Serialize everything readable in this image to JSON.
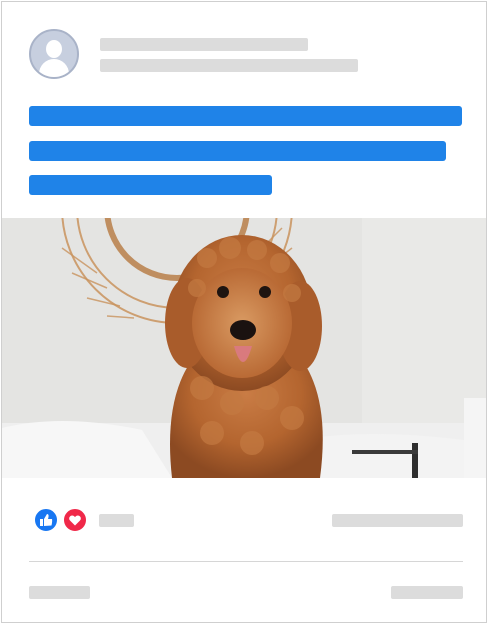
{
  "post": {
    "author_avatar": "default-avatar",
    "header_placeholders": 2,
    "text_lines": 3,
    "image": {
      "subject": "fluffy-dog"
    }
  },
  "reactions": {
    "icons": [
      "like-icon",
      "love-icon"
    ],
    "colors": {
      "like": "#1877f2",
      "love": "#f02849",
      "text_bar": "#1f83e8"
    }
  }
}
